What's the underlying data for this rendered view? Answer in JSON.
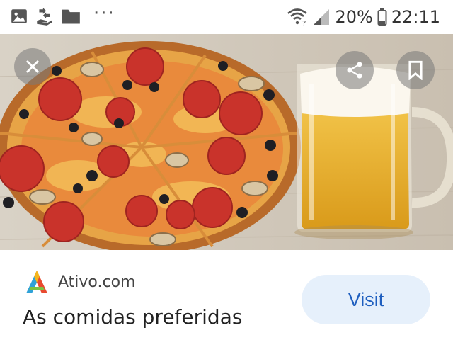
{
  "status_bar": {
    "icons": [
      "image-icon",
      "hand-transfer-icon",
      "folder-icon",
      "more-dots-icon",
      "wifi-question-icon",
      "cell-signal-icon",
      "battery-icon"
    ],
    "more": "···",
    "battery": "20%",
    "time": "22:11"
  },
  "photo": {
    "overlay_buttons": [
      "close-icon",
      "share-icon",
      "bookmark-icon"
    ]
  },
  "result": {
    "site": "Ativo.com",
    "title": "As comidas preferidas",
    "visit_label": "Visit"
  },
  "colors": {
    "visit_bg": "#e6f0fb",
    "visit_text": "#1f5fbf"
  }
}
